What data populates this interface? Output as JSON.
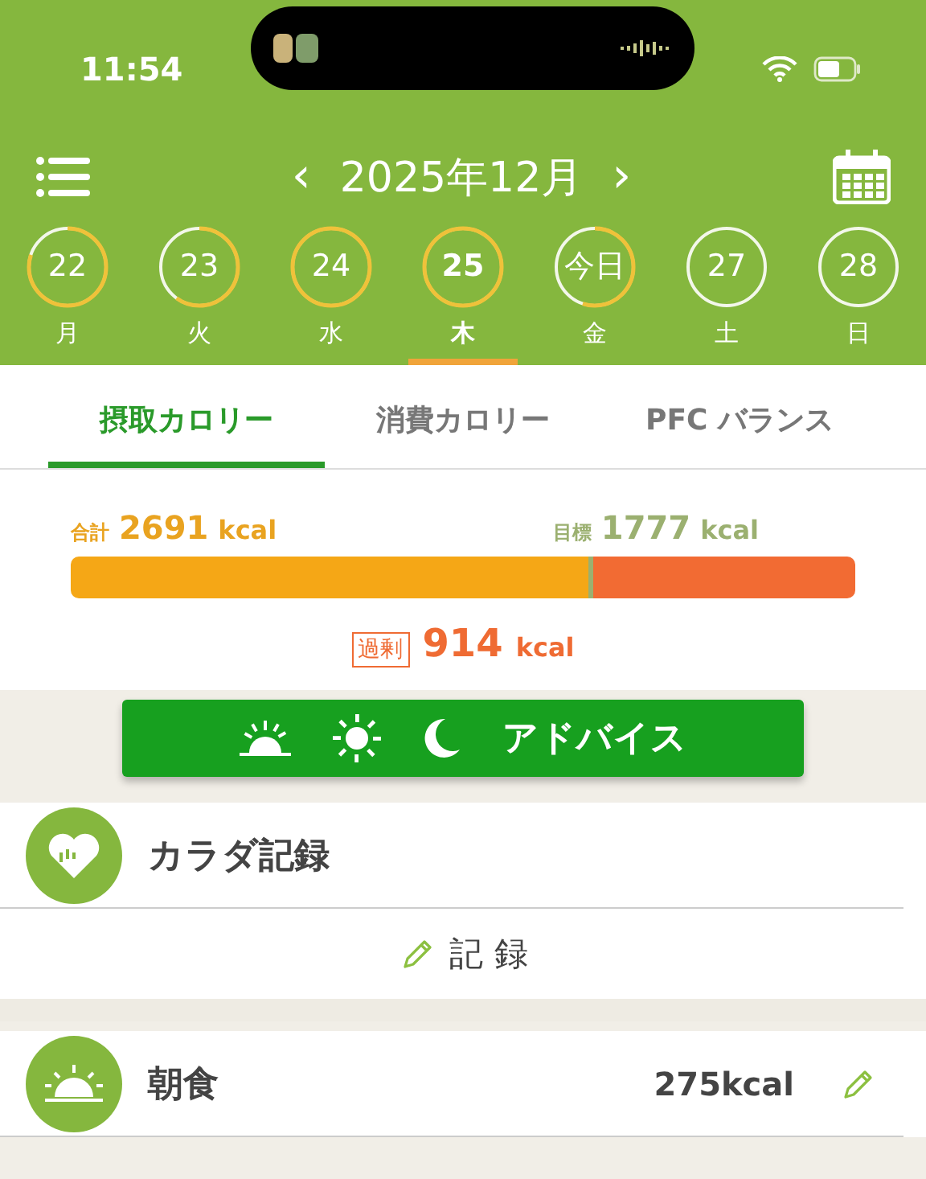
{
  "status_bar": {
    "time": "11:54"
  },
  "header": {
    "month": "2025年12月",
    "prev": "‹",
    "next": "›"
  },
  "days": [
    {
      "number": "22",
      "weekday": "月",
      "selected": false
    },
    {
      "number": "23",
      "weekday": "火",
      "selected": false
    },
    {
      "number": "24",
      "weekday": "水",
      "selected": false
    },
    {
      "number": "25",
      "weekday": "木",
      "selected": true
    },
    {
      "number": "今日",
      "weekday": "金",
      "selected": false
    },
    {
      "number": "27",
      "weekday": "土",
      "selected": false
    },
    {
      "number": "28",
      "weekday": "日",
      "selected": false
    }
  ],
  "tabs": [
    {
      "label": "摂取カロリー",
      "selected": true
    },
    {
      "label": "消費カロリー",
      "selected": false
    },
    {
      "label": "PFC バランス",
      "selected": false
    }
  ],
  "summary": {
    "total_label": "合計",
    "total_value": "2691",
    "total_unit": "kcal",
    "target_label": "目標",
    "target_value": "1777",
    "target_unit": "kcal",
    "excess_label": "過剰",
    "excess_value": "914",
    "excess_unit": "kcal"
  },
  "advice_button": {
    "label": "アドバイス"
  },
  "body_record": {
    "title": "カラダ記録",
    "action": "記 録"
  },
  "meals": [
    {
      "name": "朝食",
      "calories": "275kcal"
    }
  ]
}
